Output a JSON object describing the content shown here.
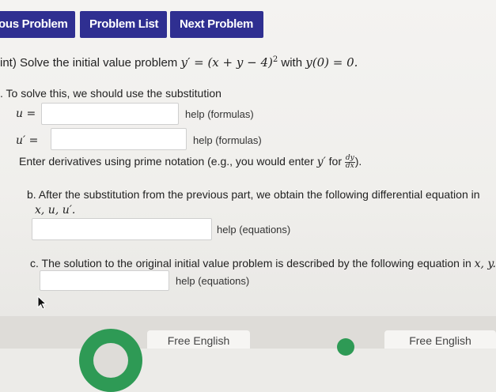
{
  "nav": {
    "prev_label": "ous Problem",
    "list_label": "Problem List",
    "next_label": "Next Problem"
  },
  "problem": {
    "prefix": "int) Solve the initial value problem",
    "equation": "y′ = (x + y − 4)",
    "exponent": "2",
    "with": "with",
    "ic": "y(0) = 0."
  },
  "part_a": {
    "intro": ". To solve this, we should use the substitution",
    "u_label": "u =",
    "uprime_label": "u′ =",
    "help1": "help (formulas)",
    "help2": "help (formulas)",
    "note_prefix": "Enter derivatives using prime notation (e.g., you would enter",
    "note_y": "y′",
    "note_for": "for",
    "frac_num": "dy",
    "frac_den": "dx",
    "note_end": ")."
  },
  "part_b": {
    "line1": "b. After the substitution from the previous part, we obtain the following differential equation in",
    "line2": "x, u, u′.",
    "help": "help (equations)"
  },
  "part_c": {
    "line1_prefix": "c. The solution to the original initial value problem is described by the following equation in",
    "line1_vars": "x, y.",
    "help": "help (equations)"
  },
  "ads": {
    "left": "Free English",
    "right": "Free English"
  },
  "colors": {
    "nav_bg": "#2f2f91",
    "ad_circle_green": "#2e9a55"
  }
}
